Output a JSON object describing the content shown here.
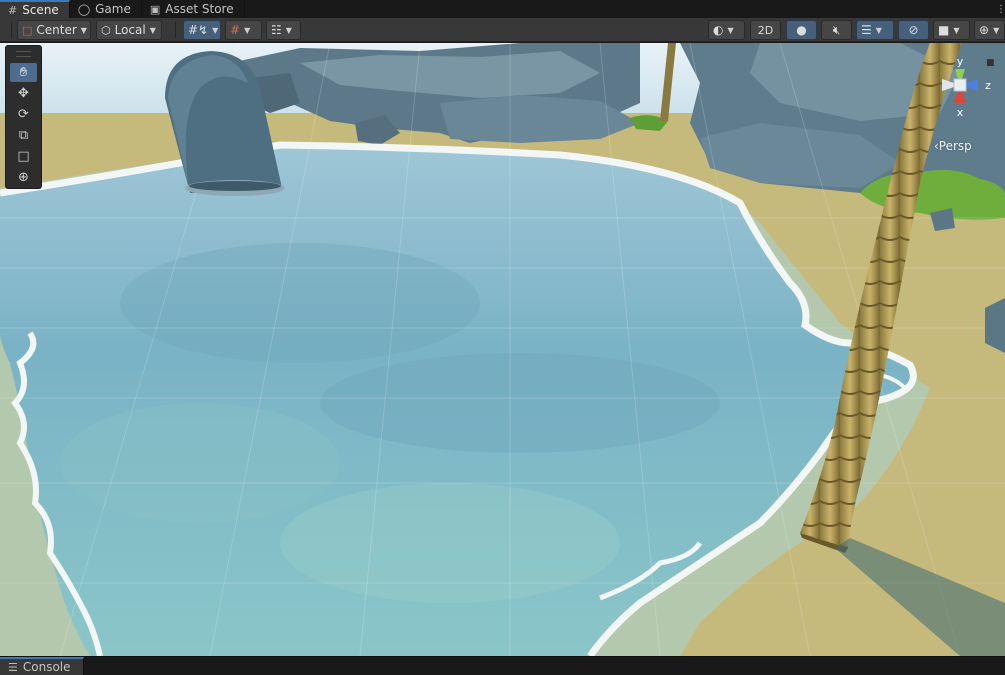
{
  "tabs": [
    {
      "label": "Scene",
      "icon": "grid-icon",
      "active": true
    },
    {
      "label": "Game",
      "icon": "gamepad-icon",
      "active": false
    },
    {
      "label": "Asset Store",
      "icon": "bag-icon",
      "active": false
    }
  ],
  "toolbar": {
    "pivot_label": "Center",
    "space_label": "Local",
    "mode_2d_label": "2D"
  },
  "tools": [
    "hand-tool",
    "move-tool",
    "rotate-tool",
    "scale-tool",
    "rect-tool",
    "transform-tool"
  ],
  "gizmo": {
    "y_label": "y",
    "z_label": "z",
    "x_label": "x",
    "projection_label": "‹Persp"
  },
  "console": {
    "label": "Console"
  },
  "colors": {
    "accent": "#3a79bb",
    "toolbar": "#383838",
    "water": "#6fb0c4",
    "sand": "#c8bb7a",
    "rock": "#5f7c8c"
  }
}
